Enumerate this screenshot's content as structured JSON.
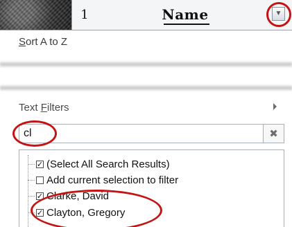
{
  "header": {
    "row_number": "1",
    "column_title": "Name",
    "dropdown_icon": "chevron-down-icon"
  },
  "menu": {
    "sort_prefix": "S",
    "sort_rest": "ort A to Z",
    "text_filters_prefix": "Text ",
    "text_filters_underlined": "F",
    "text_filters_rest": "ilters",
    "submenu_icon": "chevron-right-icon"
  },
  "search": {
    "value": "cl",
    "clear_glyph": "✖"
  },
  "list": {
    "items": [
      {
        "label": "(Select All Search Results)",
        "checked": true
      },
      {
        "label": "Add current selection to filter",
        "checked": false
      },
      {
        "label": "Clarke, David",
        "checked": true
      },
      {
        "label": "Clayton, Gregory",
        "checked": true
      }
    ]
  },
  "colors": {
    "annotation_red": "#c51313",
    "header_bg": "#e3e6eb",
    "border": "#a8aeb5"
  }
}
